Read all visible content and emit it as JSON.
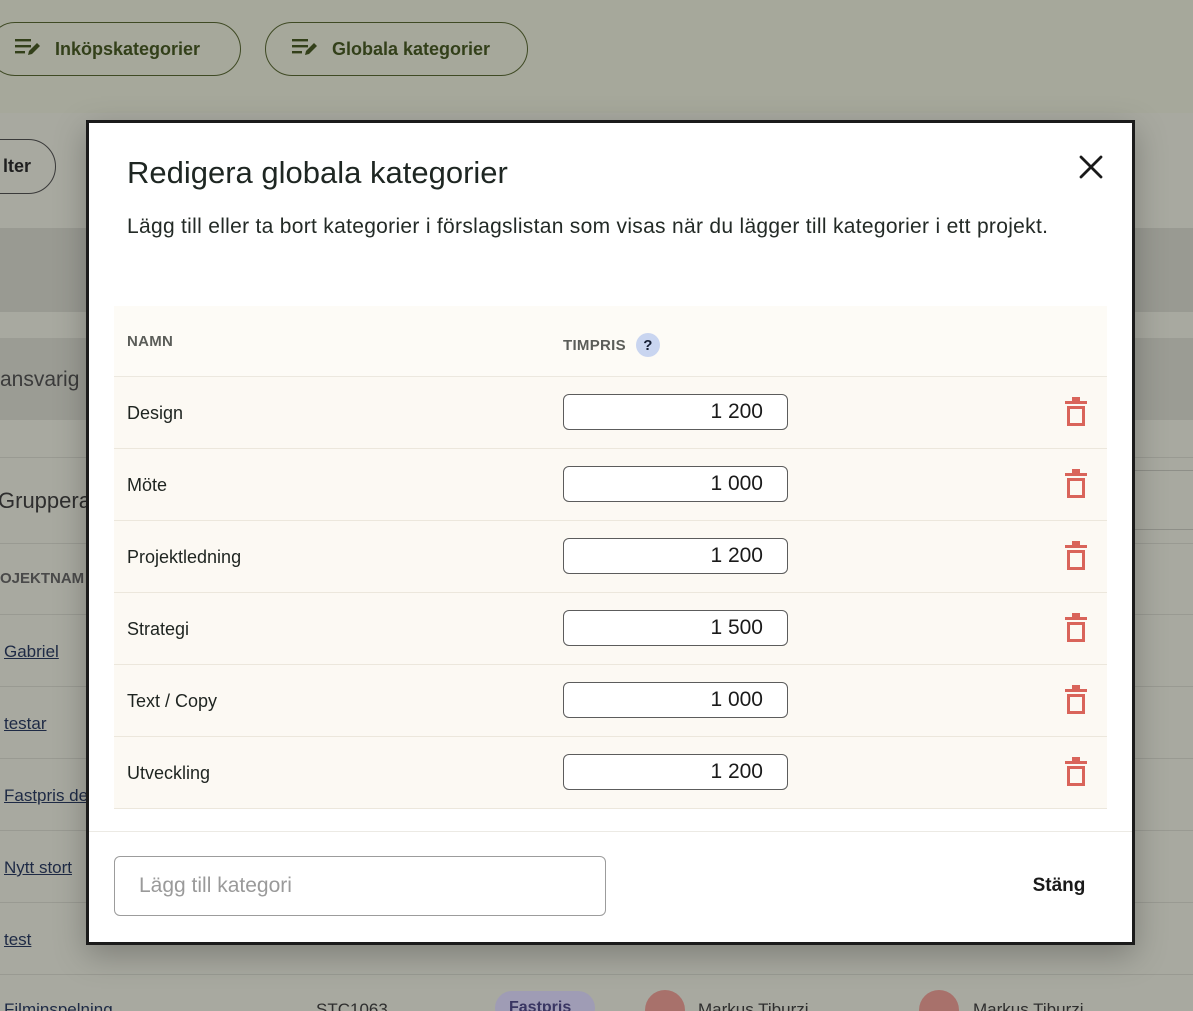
{
  "background": {
    "tabs": [
      {
        "label": "Inköpskategorier"
      },
      {
        "label": "Globala kategorier"
      }
    ],
    "filter_label": "lter",
    "ansvarig_label": "ansvarig",
    "gruppera_label": "Gruppera",
    "col_projektnamn": "OJEKTNAM",
    "rows": [
      "Gabriel",
      "testar",
      "Fastpris de",
      "Nytt stort",
      "test",
      "Filminspelning"
    ],
    "last_row_code": "STC1063",
    "last_row_badge": "Fastpris",
    "last_row_person_1": "Markus Tiburzi",
    "last_row_person_2": "Markus Tiburzi"
  },
  "modal": {
    "title": "Redigera globala kategorier",
    "description": "Lägg till eller ta bort kategorier i förslagslistan som visas när du lägger till kategorier i ett projekt.",
    "columns": {
      "name": "NAMN",
      "price": "TIMPRIS",
      "help": "?"
    },
    "categories": [
      {
        "name": "Design",
        "price": "1 200"
      },
      {
        "name": "Möte",
        "price": "1 000"
      },
      {
        "name": "Projektledning",
        "price": "1 200"
      },
      {
        "name": "Strategi",
        "price": "1 500"
      },
      {
        "name": "Text / Copy",
        "price": "1 000"
      },
      {
        "name": "Utveckling",
        "price": "1 200"
      }
    ],
    "add_placeholder": "Lägg till kategori",
    "close_label": "Stäng"
  },
  "colors": {
    "trash": "#d9645a",
    "overlay": "#a8a9a0",
    "row_bg": "#fcf9f3"
  }
}
